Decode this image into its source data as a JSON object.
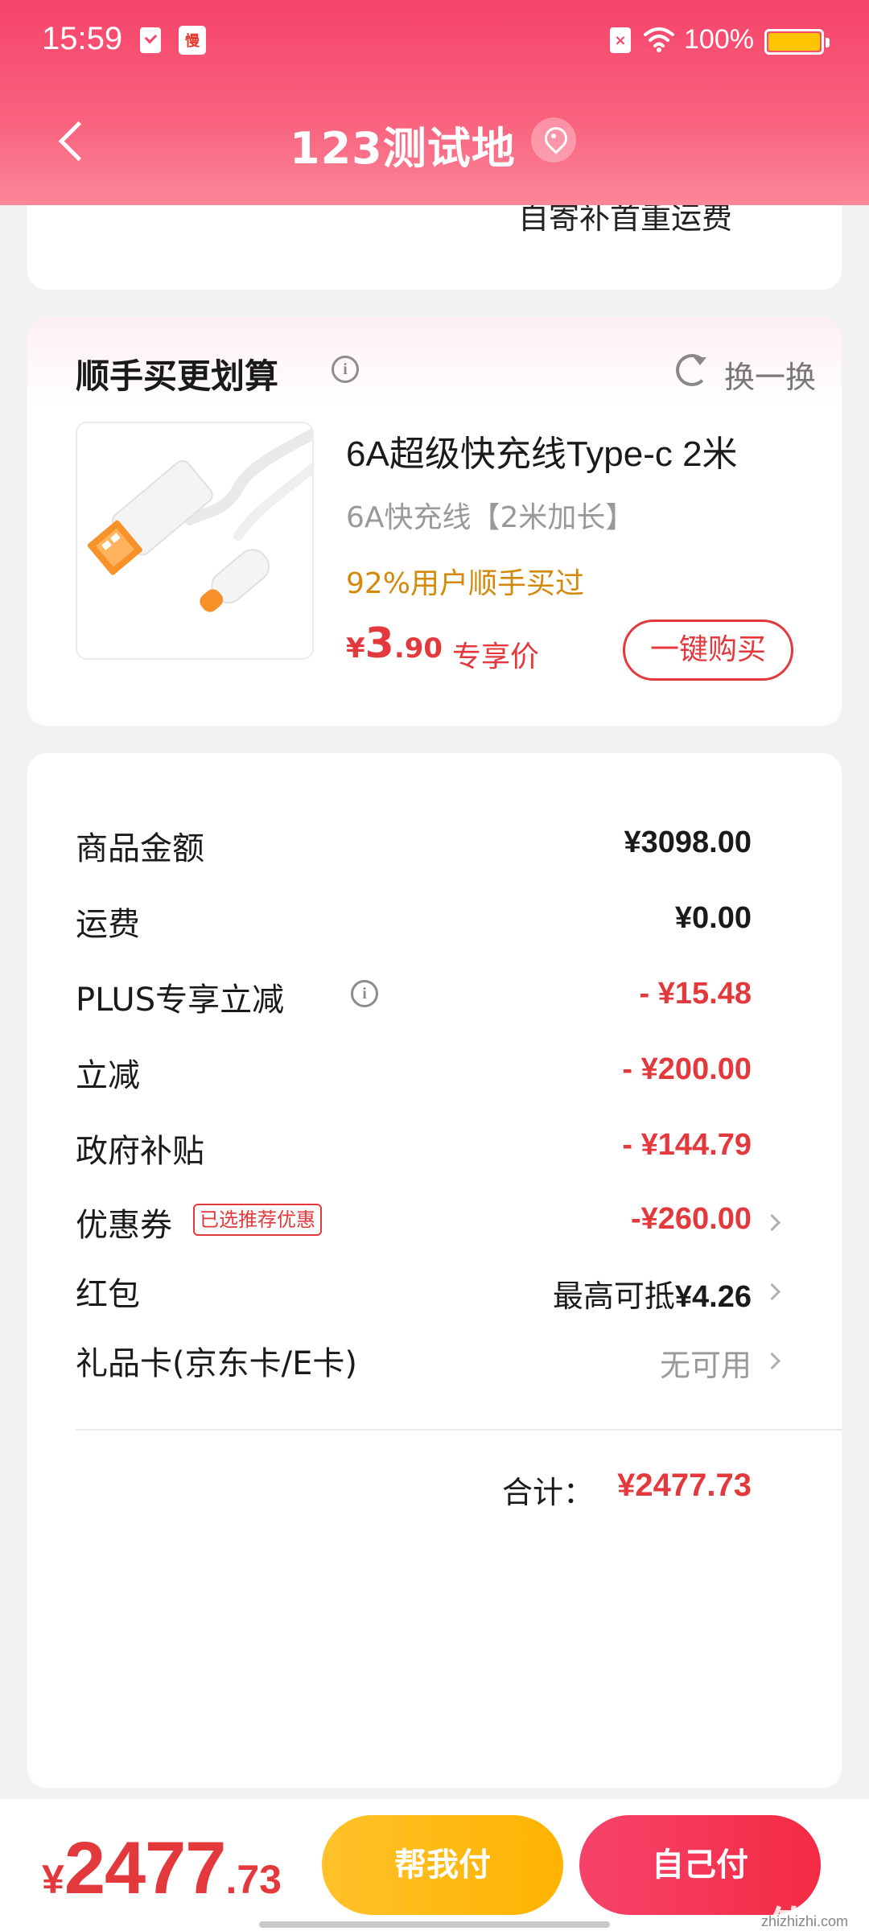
{
  "status_bar": {
    "time": "15:59",
    "battery": "100%",
    "icons": [
      "check-icon",
      "app-icon",
      "sim-icon",
      "wifi-icon",
      "battery-icon"
    ]
  },
  "header": {
    "title": "123测试地",
    "back_icon": "chevron-left-icon",
    "location_icon": "location-pin-icon"
  },
  "top_card": {
    "text": "自寄补首重运费"
  },
  "upsell": {
    "title": "顺手买更划算",
    "swap_label": "换一换",
    "product": {
      "title": "6A超级快充线Type-c 2米",
      "spec": "6A快充线【2米加长】",
      "social_proof": "92%用户顺手买过",
      "price_symbol": "¥",
      "price_integer": "3",
      "price_decimal": ".90",
      "price_tag": "专享价",
      "buy_label": "一键购买"
    }
  },
  "summary": {
    "rows": [
      {
        "label": "商品金额",
        "value": "¥3098.00"
      },
      {
        "label": "运费",
        "value": "¥0.00"
      },
      {
        "label": "PLUS专享立减",
        "value": "- ¥15.48"
      },
      {
        "label": "立减",
        "value": "- ¥200.00"
      },
      {
        "label": "政府补贴",
        "value": "- ¥144.79"
      },
      {
        "label": "优惠券",
        "badge": "已选推荐优惠",
        "value": "-¥260.00"
      },
      {
        "label": "红包",
        "value_prefix": "最高可抵",
        "value": "¥4.26"
      },
      {
        "label": "礼品卡(京东卡/E卡)",
        "value": "无可用"
      }
    ],
    "total_label": "合计：",
    "total_value": "¥2477.73"
  },
  "bottom_bar": {
    "price_symbol": "¥",
    "price_integer": "2477",
    "price_decimal": ".73",
    "help_pay_label": "帮我付",
    "self_pay_label": "自己付"
  },
  "watermark": {
    "glyph": "值值值",
    "text": "zhizhizhi.com"
  },
  "colors": {
    "accent_red": "#e4393c",
    "header_pink": "#f6436a",
    "gold": "#ffc12a"
  }
}
